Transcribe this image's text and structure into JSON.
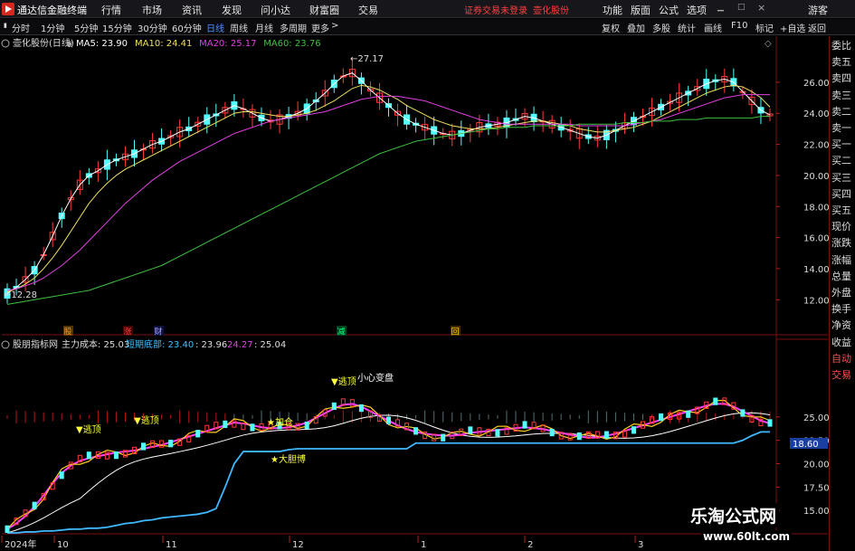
{
  "app": {
    "title": "通达信金融终端",
    "menu": [
      "行情",
      "市场",
      "资讯",
      "发现",
      "问小达",
      "财富圈",
      "交易"
    ],
    "warning": "证券交易未登录",
    "stock_name_top": "壶化股份",
    "right_menu": [
      "功能",
      "版面",
      "公式",
      "选项"
    ],
    "user": "游客"
  },
  "tabs": [
    "分时",
    "1分钟",
    "5分钟",
    "15分钟",
    "30分钟",
    "60分钟",
    "日线",
    "周线",
    "月线",
    "多周期",
    "更多"
  ],
  "active_tab": "日线",
  "tab_more_icon": "chevron-right-icon",
  "right_buttons": [
    "复权",
    "叠加",
    "多股",
    "统计",
    "画线",
    "F10",
    "标记",
    "+自选",
    "返回"
  ],
  "right_panel": [
    "委比",
    "卖五",
    "卖四",
    "卖三",
    "卖二",
    "卖一",
    "买一",
    "买二",
    "买三",
    "买四",
    "买五",
    "现价",
    "涨跌",
    "涨幅",
    "总量",
    "外盘",
    "换手",
    "净资",
    "收益",
    "自动",
    "交易"
  ],
  "main_chart": {
    "stock_label": "壶化股份(日线)",
    "ma": [
      {
        "name": "MA5",
        "value": "23.90",
        "color": "#ffffff"
      },
      {
        "name": "MA10",
        "value": "24.41",
        "color": "#f0e060"
      },
      {
        "name": "MA20",
        "value": "25.17",
        "color": "#e040e0"
      },
      {
        "name": "MA60",
        "value": "23.76",
        "color": "#40c040"
      }
    ],
    "high_label": "27.17",
    "low_label": "12.28",
    "markers": [
      {
        "text": "股",
        "color": "#ff9900",
        "bg": "#553300"
      },
      {
        "text": "涨",
        "color": "#ff4040",
        "bg": "#400000"
      },
      {
        "text": "财",
        "color": "#a0a0ff",
        "bg": "#101040"
      },
      {
        "text": "减",
        "color": "#00ff80",
        "bg": "#004020"
      },
      {
        "text": "回",
        "color": "#ffcc00",
        "bg": "#403000"
      }
    ]
  },
  "sub_chart": {
    "indicator_name": "股朋指标网",
    "main_cost_label": "主力成本",
    "main_cost_value": "25.03",
    "short_bottom_label": "短期底部",
    "v1": "23.40",
    "v2": "23.96",
    "v3": "24.27",
    "v4": "25.04",
    "annotations": [
      {
        "text": "▼逃顶",
        "color": "#ffff40"
      },
      {
        "text": "▼逃顶",
        "color": "#ffff40"
      },
      {
        "text": "▼逃顶",
        "color": "#ffff40"
      },
      {
        "text": "小心变盘",
        "color": "#ffffff"
      },
      {
        "text": "★加仓",
        "color": "#ffff40"
      },
      {
        "text": "★大胆博",
        "color": "#ffff40"
      }
    ],
    "current_price_tag": "18.60"
  },
  "chart_data": [
    {
      "type": "candlestick",
      "title": "壶化股份(日线)",
      "y_ticks": [
        "12.00",
        "14.00",
        "16.00",
        "18.00",
        "20.00",
        "22.00",
        "24.00",
        "26.00"
      ],
      "ylim": [
        11.2,
        27.8
      ],
      "x_ticks": [
        "2024年",
        "10",
        "11",
        "12",
        "1",
        "2",
        "3"
      ],
      "series": [
        {
          "name": "MA5",
          "values": [
            12.4,
            12.8,
            13.3,
            13.9,
            14.9,
            16.1,
            17.4,
            18.5,
            19.4,
            20.0,
            20.3,
            20.7,
            21.0,
            21.2,
            21.4,
            21.7,
            22.0,
            22.2,
            22.5,
            22.8,
            23.0,
            23.3,
            23.6,
            23.9,
            24.2,
            24.5,
            24.3,
            24.0,
            23.7,
            23.5,
            23.6,
            23.8,
            24.0,
            24.3,
            24.8,
            25.3,
            25.9,
            26.4,
            26.6,
            26.1,
            25.5,
            25.0,
            24.5,
            24.0,
            23.6,
            23.3,
            23.1,
            22.9,
            22.7,
            22.6,
            22.7,
            22.9,
            23.1,
            23.2,
            23.3,
            23.4,
            23.6,
            23.8,
            23.7,
            23.5,
            23.3,
            23.1,
            22.9,
            22.7,
            22.5,
            22.4,
            22.6,
            22.9,
            23.2,
            23.5,
            23.8,
            24.1,
            24.4,
            24.7,
            25.0,
            25.3,
            25.6,
            25.9,
            26.1,
            26.2,
            26.0,
            25.4,
            24.8,
            24.2,
            23.9
          ]
        },
        {
          "name": "MA10",
          "values": [
            12.5,
            12.7,
            13.0,
            13.4,
            14.0,
            14.7,
            15.5,
            16.4,
            17.3,
            18.2,
            18.9,
            19.5,
            20.0,
            20.4,
            20.7,
            21.0,
            21.3,
            21.6,
            21.9,
            22.2,
            22.5,
            22.8,
            23.1,
            23.4,
            23.7,
            24.0,
            24.1,
            24.1,
            24.0,
            23.9,
            23.8,
            23.8,
            23.9,
            24.0,
            24.2,
            24.5,
            24.8,
            25.2,
            25.6,
            25.8,
            25.7,
            25.5,
            25.2,
            24.9,
            24.5,
            24.2,
            23.9,
            23.6,
            23.4,
            23.2,
            23.1,
            23.0,
            23.0,
            23.0,
            23.1,
            23.2,
            23.3,
            23.4,
            23.5,
            23.5,
            23.4,
            23.3,
            23.2,
            23.0,
            22.9,
            22.8,
            22.8,
            22.9,
            23.0,
            23.1,
            23.3,
            23.5,
            23.8,
            24.1,
            24.4,
            24.7,
            25.0,
            25.3,
            25.5,
            25.7,
            25.8,
            25.7,
            25.4,
            25.0,
            24.4
          ]
        },
        {
          "name": "MA20",
          "values": [
            12.6,
            12.7,
            12.9,
            13.1,
            13.4,
            13.8,
            14.2,
            14.7,
            15.2,
            15.8,
            16.4,
            17.0,
            17.6,
            18.2,
            18.7,
            19.2,
            19.7,
            20.1,
            20.5,
            20.9,
            21.2,
            21.5,
            21.8,
            22.1,
            22.4,
            22.7,
            22.9,
            23.1,
            23.3,
            23.5,
            23.6,
            23.7,
            23.8,
            23.9,
            24.0,
            24.1,
            24.3,
            24.5,
            24.7,
            24.9,
            25.0,
            25.1,
            25.1,
            25.1,
            25.0,
            24.9,
            24.8,
            24.6,
            24.4,
            24.2,
            24.0,
            23.8,
            23.6,
            23.5,
            23.4,
            23.3,
            23.3,
            23.3,
            23.3,
            23.3,
            23.3,
            23.3,
            23.3,
            23.2,
            23.2,
            23.2,
            23.2,
            23.2,
            23.2,
            23.3,
            23.4,
            23.5,
            23.6,
            23.8,
            24.0,
            24.2,
            24.4,
            24.6,
            24.8,
            25.0,
            25.1,
            25.2,
            25.2,
            25.2,
            25.2
          ]
        },
        {
          "name": "MA60",
          "values": [
            11.7,
            11.8,
            11.9,
            12.0,
            12.1,
            12.2,
            12.3,
            12.4,
            12.5,
            12.6,
            12.8,
            13.0,
            13.2,
            13.4,
            13.6,
            13.8,
            14.0,
            14.2,
            14.5,
            14.8,
            15.1,
            15.4,
            15.7,
            16.0,
            16.3,
            16.6,
            16.9,
            17.2,
            17.5,
            17.8,
            18.1,
            18.4,
            18.7,
            19.0,
            19.3,
            19.6,
            19.9,
            20.2,
            20.5,
            20.8,
            21.1,
            21.4,
            21.6,
            21.8,
            22.0,
            22.2,
            22.3,
            22.4,
            22.5,
            22.6,
            22.7,
            22.8,
            22.9,
            23.0,
            23.0,
            23.1,
            23.1,
            23.1,
            23.2,
            23.2,
            23.2,
            23.2,
            23.2,
            23.3,
            23.3,
            23.3,
            23.3,
            23.3,
            23.4,
            23.4,
            23.4,
            23.5,
            23.5,
            23.5,
            23.6,
            23.6,
            23.6,
            23.7,
            23.7,
            23.7,
            23.7,
            23.7,
            23.7,
            23.8,
            23.8
          ]
        }
      ]
    },
    {
      "type": "line",
      "title": "股朋指标网",
      "y_ticks": [
        "15.00",
        "17.50",
        "20.00",
        "22.50",
        "25.00"
      ],
      "ylim": [
        12.5,
        27.5
      ],
      "series": [
        {
          "name": "主力成本",
          "values": [
            13.0,
            13.6,
            14.4,
            15.4,
            16.6,
            17.9,
            19.0,
            19.8,
            20.3,
            20.6,
            20.8,
            21.0,
            21.2,
            21.3,
            21.4,
            21.6,
            21.8,
            22.0,
            22.3,
            22.6,
            22.9,
            23.2,
            23.5,
            23.8,
            24.1,
            24.4,
            24.3,
            24.1,
            23.9,
            23.8,
            23.8,
            23.9,
            24.1,
            24.4,
            24.9,
            25.4,
            25.9,
            26.3,
            26.4,
            26.1,
            25.6,
            25.1,
            24.6,
            24.1,
            23.7,
            23.4,
            23.2,
            23.1,
            23.0,
            23.0,
            23.1,
            23.3,
            23.4,
            23.5,
            23.6,
            23.7,
            23.8,
            23.9,
            23.8,
            23.7,
            23.5,
            23.3,
            23.1,
            22.9,
            22.8,
            22.8,
            23.0,
            23.2,
            23.5,
            23.8,
            24.1,
            24.4,
            24.7,
            25.0,
            25.3,
            25.6,
            25.9,
            26.2,
            26.4,
            26.4,
            26.1,
            25.6,
            25.1,
            24.6,
            24.3
          ]
        },
        {
          "name": "短期底部",
          "values": [
            12.6,
            12.6,
            12.7,
            12.7,
            12.8,
            12.8,
            12.9,
            13.0,
            13.0,
            13.1,
            13.1,
            13.2,
            13.4,
            13.6,
            13.7,
            13.9,
            14.0,
            14.2,
            14.3,
            14.4,
            14.5,
            14.6,
            14.8,
            15.2,
            17.5,
            20.0,
            21.3,
            21.3,
            21.3,
            21.3,
            21.3,
            21.5,
            21.6,
            21.6,
            21.6,
            21.6,
            21.6,
            21.6,
            21.6,
            21.6,
            21.6,
            21.6,
            21.6,
            21.6,
            21.6,
            22.2,
            22.2,
            22.2,
            22.2,
            22.2,
            22.2,
            22.2,
            22.2,
            22.2,
            22.2,
            22.2,
            22.2,
            22.2,
            22.2,
            22.2,
            22.2,
            22.2,
            22.2,
            22.2,
            22.2,
            22.2,
            22.2,
            22.2,
            22.2,
            22.2,
            22.2,
            22.2,
            22.2,
            22.2,
            22.2,
            22.2,
            22.2,
            22.2,
            22.2,
            22.2,
            22.2,
            22.5,
            23.0,
            23.4,
            23.4
          ]
        }
      ]
    }
  ]
}
